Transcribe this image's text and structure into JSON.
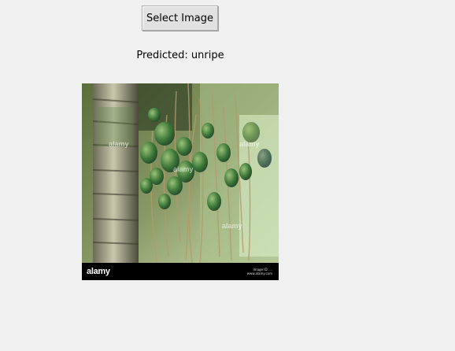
{
  "toolbar": {
    "select_label": "Select Image"
  },
  "prediction": {
    "text": "Predicted: unripe"
  },
  "image": {
    "description_icon": "photo-image",
    "watermark_logo": "alamy",
    "watermark_faint": "alamy",
    "side_text_line1": "Image ID: ...",
    "side_text_line2": "www.alamy.com"
  },
  "colors": {
    "window_bg": "#f0f0f0",
    "button_bg": "#e1e1e1",
    "button_border": "#adadad"
  }
}
